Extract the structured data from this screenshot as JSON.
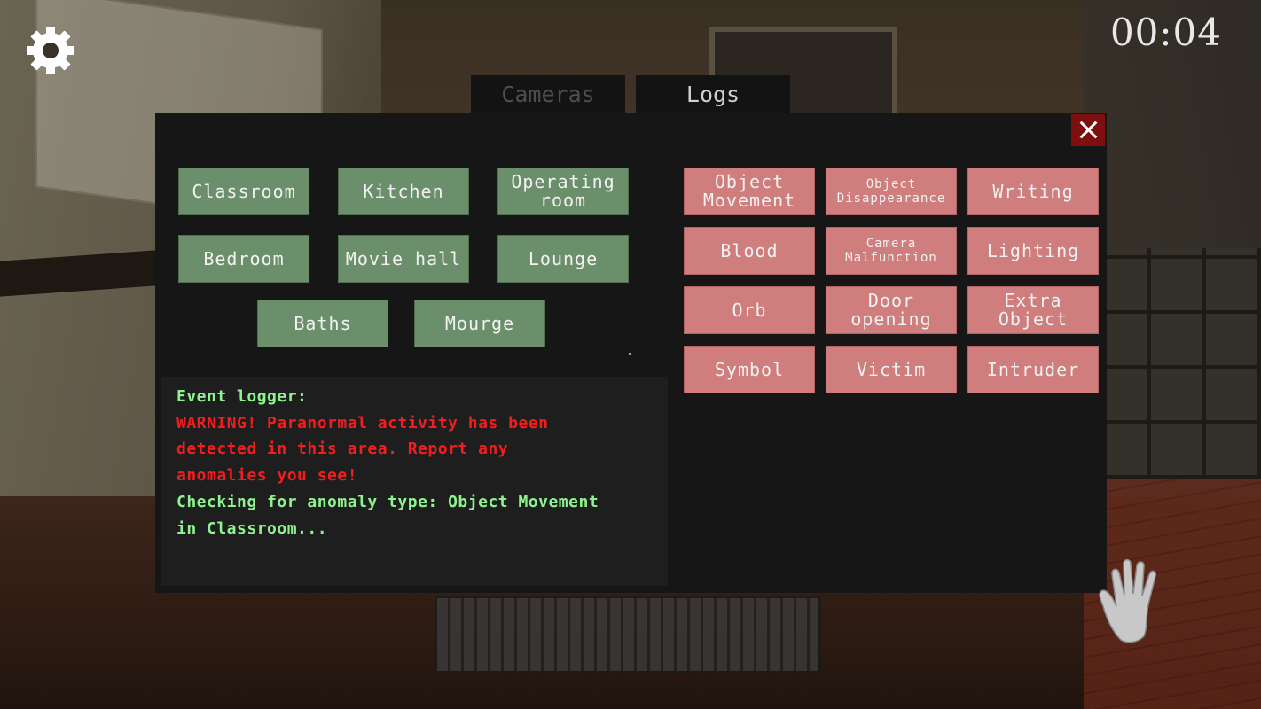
{
  "hud": {
    "timer": "00:04",
    "settings_icon": "gear-icon",
    "interact_icon": "hand-icon"
  },
  "tabs": [
    {
      "label": "Cameras",
      "active": false
    },
    {
      "label": "Logs",
      "active": true
    }
  ],
  "rooms": [
    "Classroom",
    "Kitchen",
    "Operating\nroom",
    "Bedroom",
    "Movie hall",
    "Lounge",
    "Baths",
    "Mourge"
  ],
  "anomalies": [
    "Object\nMovement",
    "Object\nDisappearance",
    "Writing",
    "Blood",
    "Camera\nMalfunction",
    "Lighting",
    "Orb",
    "Door\nopening",
    "Extra\nObject",
    "Symbol",
    "Victim",
    "Intruder"
  ],
  "logger": {
    "lines": [
      {
        "text": "Event logger:",
        "color": "green"
      },
      {
        "text": "WARNING! Paranormal activity has been",
        "color": "red"
      },
      {
        "text": "detected in this area. Report any",
        "color": "red"
      },
      {
        "text": "anomalies you see!",
        "color": "red"
      },
      {
        "text": "Checking for anomaly type: Object Movement",
        "color": "green"
      },
      {
        "text": "in Classroom...",
        "color": "green"
      }
    ]
  },
  "colors": {
    "room_button": "#6b8f6b",
    "anomaly_button": "#cf7d7d",
    "close_button": "#7d0f0f",
    "log_green": "#8ef38e",
    "log_red": "#f41d1d"
  }
}
